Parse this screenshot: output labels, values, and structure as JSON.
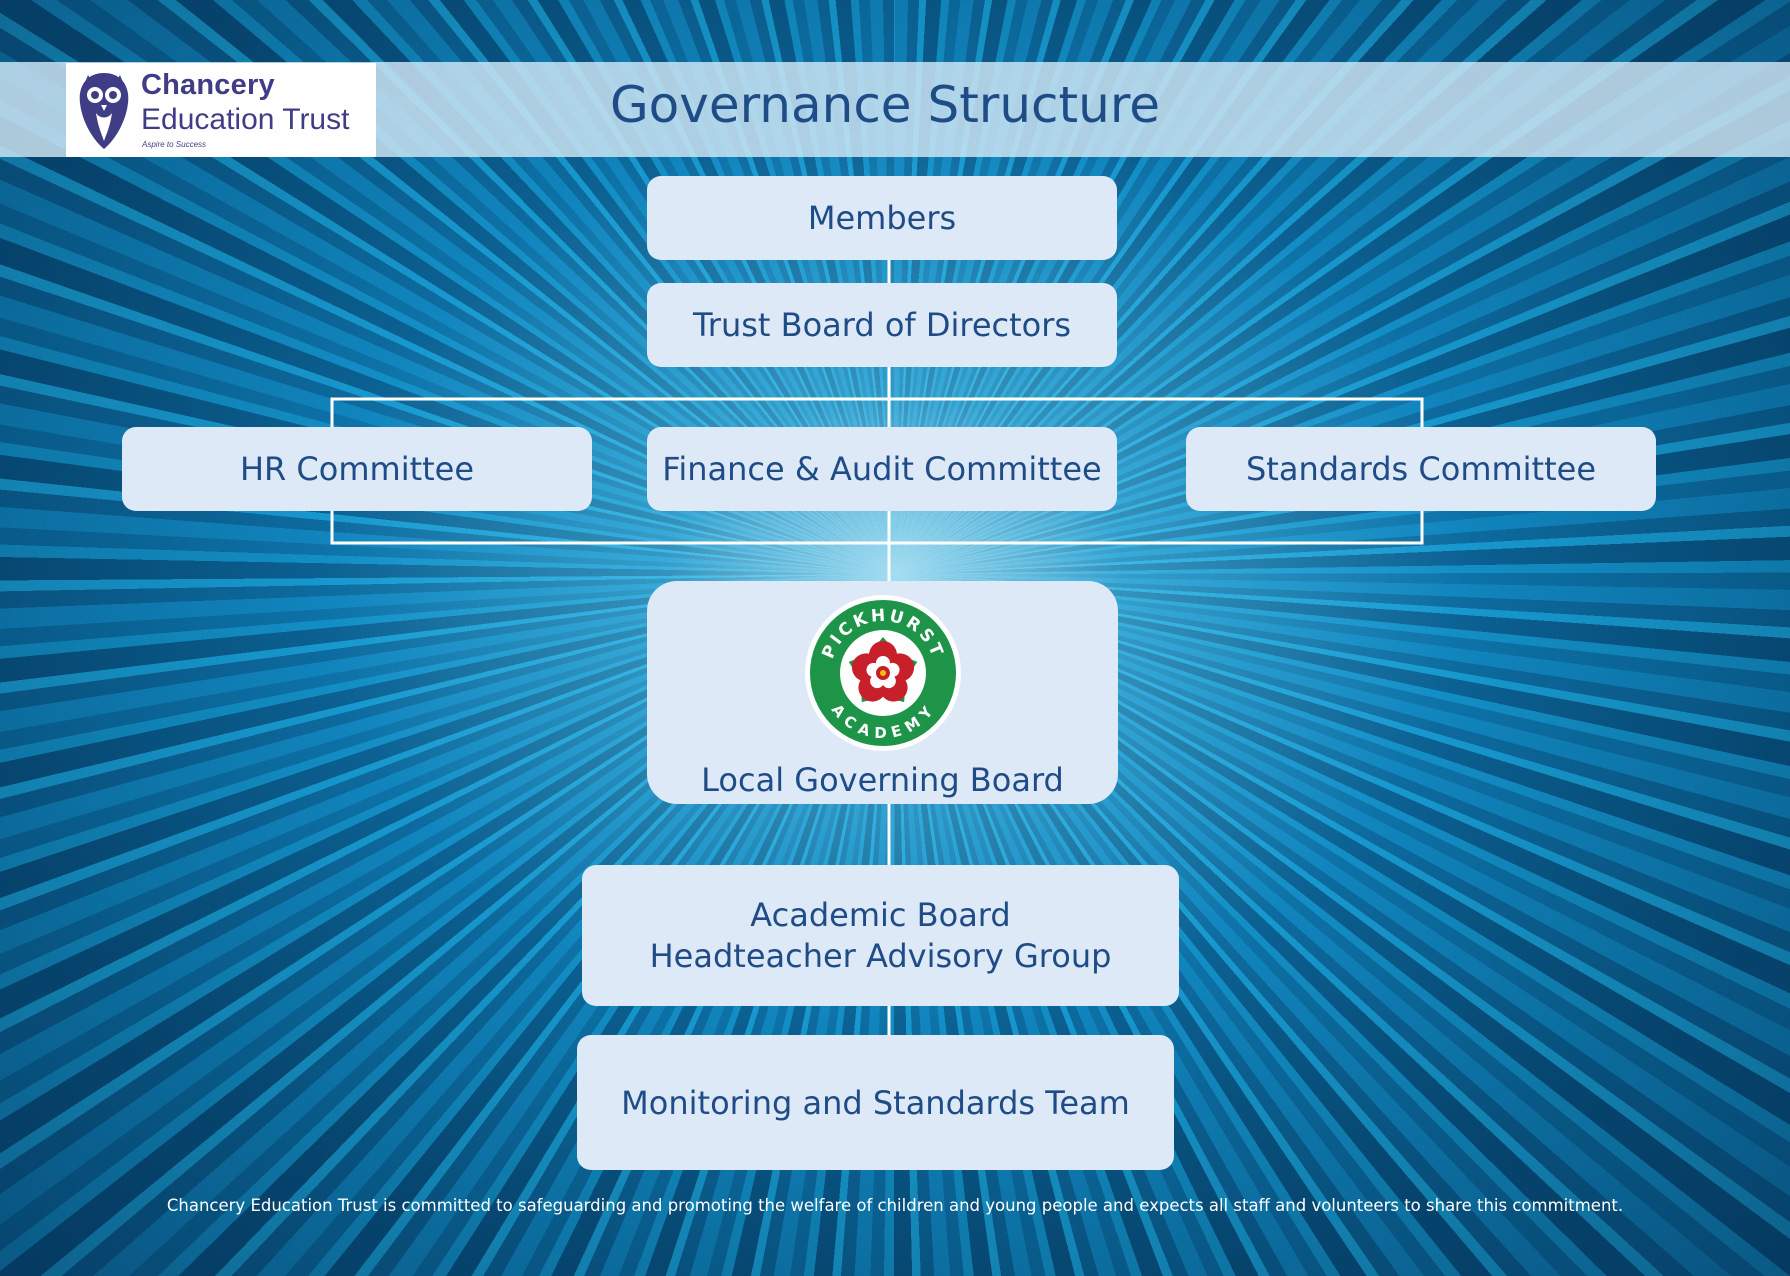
{
  "header": {
    "title": "Governance Structure",
    "logo": {
      "line1": "Chancery",
      "line2": "Education Trust",
      "tagline": "Aspire to Success"
    }
  },
  "nodes": {
    "members": "Members",
    "trust_board": "Trust Board of Directors",
    "hr_committee": "HR Committee",
    "finance_committee": "Finance & Audit Committee",
    "standards_committee": "Standards Committee",
    "local_governing_board": "Local Governing Board",
    "academic_board_line1": "Academic Board",
    "academic_board_line2": "Headteacher Advisory Group",
    "monitoring_team": "Monitoring and Standards Team"
  },
  "crest": {
    "top_text": "PICKHURST",
    "bottom_text": "ACADEMY",
    "ring_color": "#1e9448",
    "rose_color": "#c8202a"
  },
  "footer": "Chancery Education Trust is committed to safeguarding and promoting the welfare of children and young people and expects all staff and volunteers to share this commitment.",
  "colors": {
    "box_fill": "#dde9f6",
    "text": "#1f4c86",
    "logo_text": "#3f3d86"
  }
}
